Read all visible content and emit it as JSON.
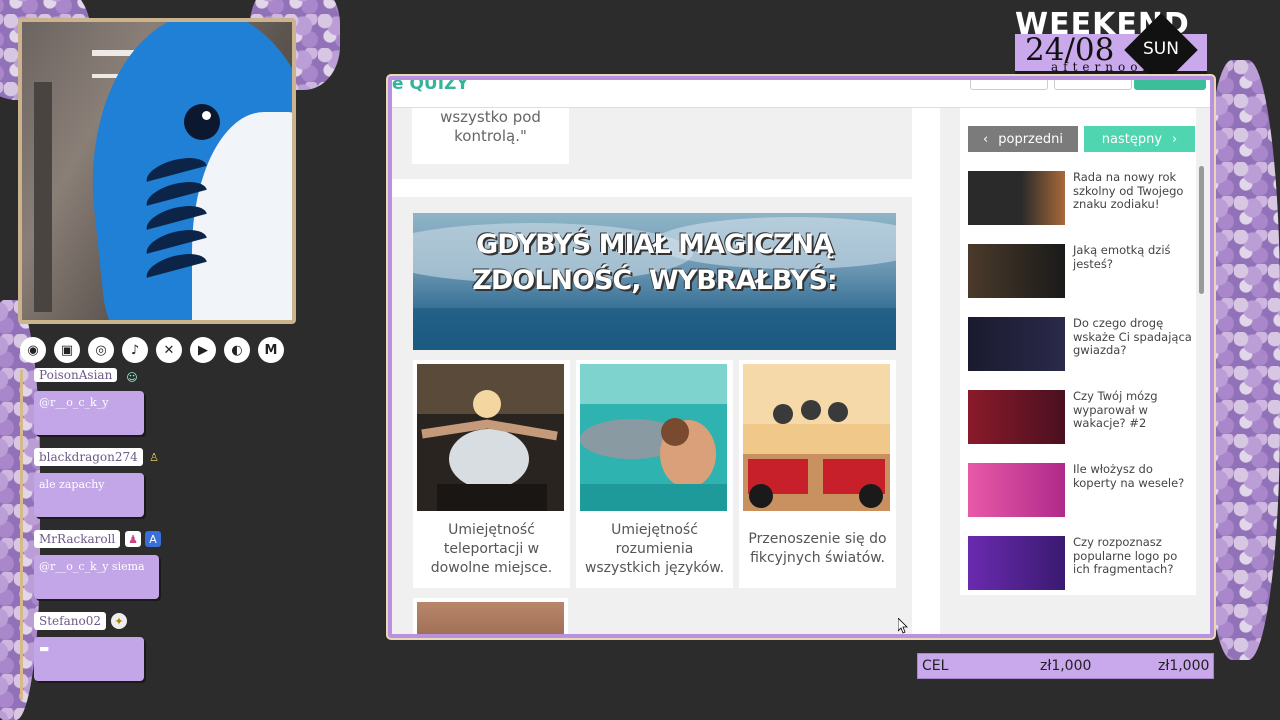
{
  "branding": {
    "weekend_title": "WEEKEND",
    "date": "24/08",
    "day": "SUN",
    "part_of_day": "afternoon"
  },
  "social_icons": [
    "pioneer-icon",
    "twitch-icon",
    "instagram-icon",
    "tiktok-icon",
    "x-icon",
    "youtube-icon",
    "discord-icon",
    "mail-icon"
  ],
  "chat": [
    {
      "user": "PoisonAsian",
      "message": "@r__o_c_k_y"
    },
    {
      "user": "blackdragon274",
      "message": "ale zapachy"
    },
    {
      "user": "MrRackaroll",
      "message": "@r__o_c_k_y siema"
    },
    {
      "user": "Stefano02",
      "message": "▬"
    }
  ],
  "browser": {
    "previous_answer": "wszystko pod kontrolą.\"",
    "question": "GDYBYŚ MIAŁ MAGICZNĄ ZDOLNOŚĆ, WYBRAŁBYŚ:",
    "answers": [
      "Umiejętność teleportacji w dowolne miejsce.",
      "Umiejętność rozumienia wszystkich języków.",
      "Przenoszenie się do fikcyjnych światów."
    ],
    "nav": {
      "prev": "poprzedni",
      "next": "następny"
    },
    "related": [
      "Rada na nowy rok szkolny od Twojego znaku zodiaku!",
      "Jaką emotką dziś jesteś?",
      "Do czego drogę wskaże Ci spadająca gwiazda?",
      "Czy Twój mózg wyparował w wakacje? #2",
      "Ile włożysz do koperty na wesele?",
      "Czy rozpoznasz popularne logo po ich fragmentach?"
    ]
  },
  "goal": {
    "label": "CEL",
    "current": "zł1,000",
    "target": "zł1,000"
  },
  "colors": {
    "accent": "#c9a8ec",
    "teal": "#4fd6b0",
    "frame": "#b891e0"
  }
}
